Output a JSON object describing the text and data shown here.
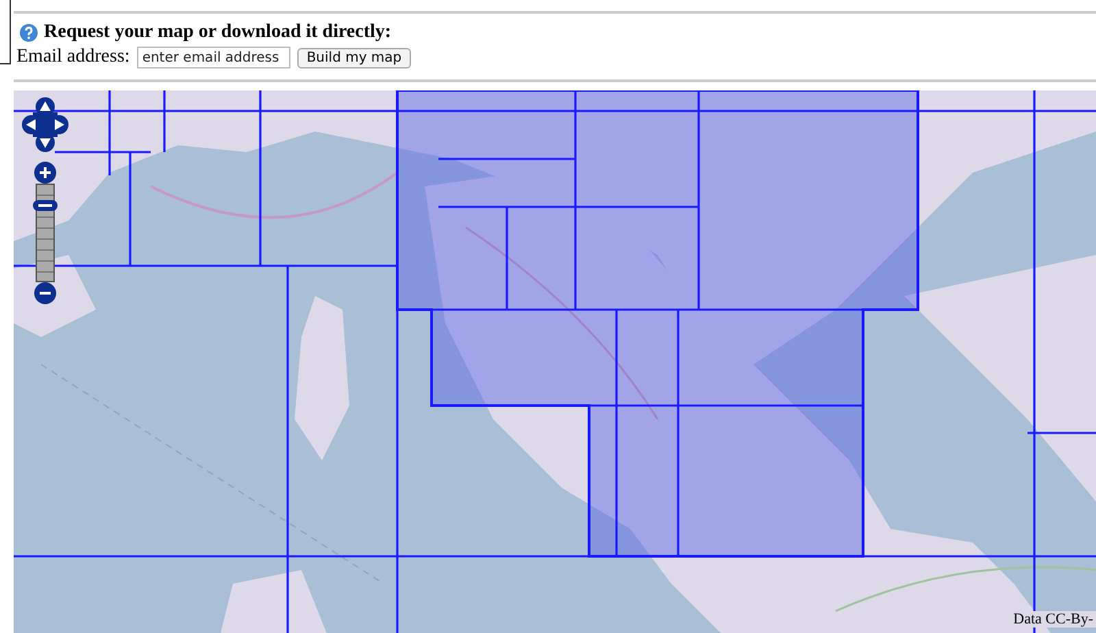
{
  "request": {
    "title": "Request your map or download it directly:",
    "email_label": "Email address:",
    "email_field": {
      "placeholder": "enter email address"
    },
    "button": "Build my map"
  },
  "map": {
    "kind": "picture",
    "zoom": {
      "level": 0.78
    },
    "attribution": "Data CC-By-"
  }
}
